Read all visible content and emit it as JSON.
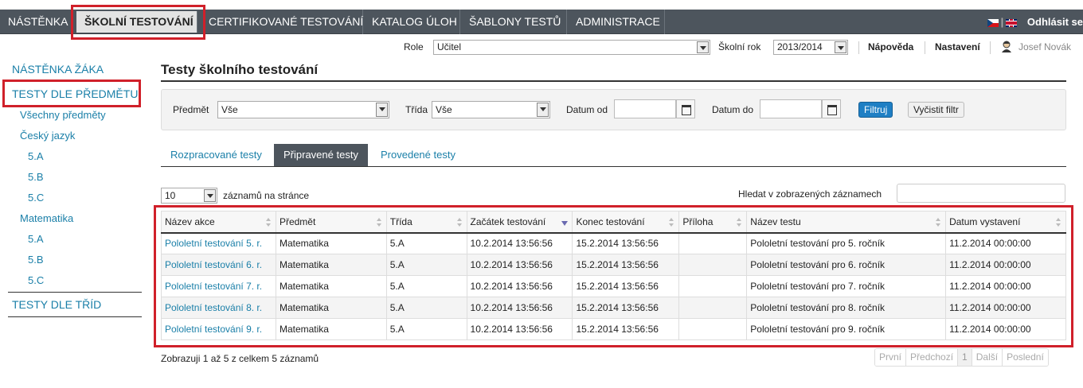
{
  "nav": {
    "items": [
      "NÁSTĚNKA",
      "ŠKOLNÍ TESTOVÁNÍ",
      "CERTIFIKOVANÉ TESTOVÁNÍ",
      "KATALOG ÚLOH",
      "ŠABLONY TESTŮ",
      "ADMINISTRACE"
    ],
    "active_index": 1,
    "logout": "Odhlásit se"
  },
  "toolbar": {
    "role_label": "Role",
    "role_value": "Učitel",
    "year_label": "Školní rok",
    "year_value": "2013/2014",
    "help": "Nápověda",
    "settings": "Nastavení",
    "user": "Josef Novák"
  },
  "sidebar": {
    "items": [
      {
        "label": "NÁSTĚNKA ŽÁKA",
        "level": 0
      },
      {
        "label": "TESTY DLE PŘEDMĚTU",
        "level": 0
      },
      {
        "label": "Všechny předměty",
        "level": 1
      },
      {
        "label": "Český jazyk",
        "level": 1
      },
      {
        "label": "5.A",
        "level": 2
      },
      {
        "label": "5.B",
        "level": 2
      },
      {
        "label": "5.C",
        "level": 2
      },
      {
        "label": "Matematika",
        "level": 1
      },
      {
        "label": "5.A",
        "level": 2
      },
      {
        "label": "5.B",
        "level": 2
      },
      {
        "label": "5.C",
        "level": 2
      },
      {
        "label": "TESTY DLE TŘÍD",
        "level": 0
      }
    ]
  },
  "main": {
    "title": "Testy školního testování",
    "filter": {
      "subject_label": "Předmět",
      "subject_value": "Vše",
      "class_label": "Třída",
      "class_value": "Vše",
      "date_from_label": "Datum od",
      "date_to_label": "Datum do",
      "filter_button": "Filtruj",
      "clear_button": "Vyčistit filtr"
    },
    "tabs": [
      "Rozpracované testy",
      "Připravené testy",
      "Provedené testy"
    ],
    "active_tab": 1,
    "page_size_value": "10",
    "page_size_label": "záznamů na stránce",
    "search_label": "Hledat v zobrazených záznamech",
    "columns": [
      "Název akce",
      "Předmět",
      "Třída",
      "Začátek testování",
      "Konec testování",
      "Příloha",
      "Název testu",
      "Datum vystavení"
    ],
    "rows": [
      [
        "Pololetní testování 5. r.",
        "Matematika",
        "5.A",
        "10.2.2014 13:56:56",
        "15.2.2014 13:56:56",
        "",
        "Pololetní testování pro 5. ročník",
        "11.2.2014 00:00:00"
      ],
      [
        "Pololetní testování 6. r.",
        "Matematika",
        "5.A",
        "10.2.2014 13:56:56",
        "15.2.2014 13:56:56",
        "",
        "Pololetní testování pro 6. ročník",
        "11.2.2014 00:00:00"
      ],
      [
        "Pololetní testování 7. r.",
        "Matematika",
        "5.A",
        "10.2.2014 13:56:56",
        "15.2.2014 13:56:56",
        "",
        "Pololetní testování pro 7. ročník",
        "11.2.2014 00:00:00"
      ],
      [
        "Pololetní testování 8. r.",
        "Matematika",
        "5.A",
        "10.2.2014 13:56:56",
        "15.2.2014 13:56:56",
        "",
        "Pololetní testování pro 8. ročník",
        "11.2.2014 00:00:00"
      ],
      [
        "Pololetní testování 9. r.",
        "Matematika",
        "5.A",
        "10.2.2014 13:56:56",
        "15.2.2014 13:56:56",
        "",
        "Pololetní testování pro 9. ročník",
        "11.2.2014 00:00:00"
      ]
    ],
    "info": "Zobrazuji 1 až 5 z celkem 5 záznamů",
    "pager": {
      "first": "První",
      "prev": "Předchozí",
      "current": "1",
      "next": "Další",
      "last": "Poslední"
    }
  },
  "colors": {
    "nav_bg": "#4d555d",
    "link": "#1a7fa8",
    "highlight": "#d0202a",
    "button": "#1f7fc4"
  }
}
